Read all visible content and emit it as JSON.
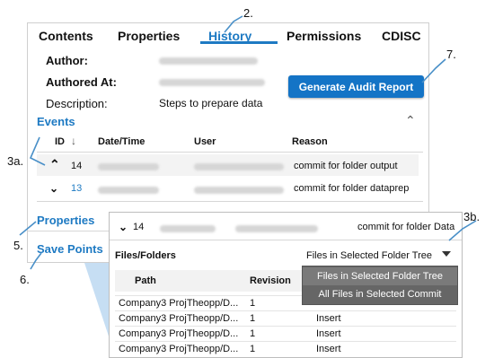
{
  "tabs": [
    "Contents",
    "Properties",
    "History",
    "Permissions",
    "CDISC"
  ],
  "active_tab": "History",
  "meta": {
    "author_label": "Author:",
    "authored_at_label": "Authored At:",
    "description_label": "Description:",
    "description_value": "Steps to prepare data"
  },
  "generate_button": "Generate Audit Report",
  "events": {
    "title": "Events",
    "headers": {
      "id": "ID",
      "datetime": "Date/Time",
      "user": "User",
      "reason": "Reason"
    },
    "rows": [
      {
        "id": "14",
        "reason": "commit for folder output"
      },
      {
        "id": "13",
        "reason": "commit for folder dataprep"
      }
    ]
  },
  "sections": {
    "properties": "Properties",
    "save_points": "Save Points"
  },
  "popup": {
    "id": "14",
    "reason": "commit for folder Data",
    "files_label": "Files/Folders",
    "dropdown_value": "Files in Selected Folder Tree",
    "headers": {
      "path": "Path",
      "revision": "Revision"
    },
    "rows": [
      {
        "path": "Company3 ProjTheopp/D...",
        "revision": "1",
        "action": ""
      },
      {
        "path": "Company3 ProjTheopp/D...",
        "revision": "1",
        "action": "Insert"
      },
      {
        "path": "Company3 ProjTheopp/D...",
        "revision": "1",
        "action": "Insert"
      },
      {
        "path": "Company3 ProjTheopp/D...",
        "revision": "1",
        "action": "Insert"
      }
    ],
    "menu": [
      "Files in Selected Folder Tree",
      "All Files in Selected Commit"
    ]
  },
  "callouts": {
    "c2": "2.",
    "c7": "7.",
    "c3a": "3a.",
    "c3b": "3b.",
    "c5": "5.",
    "c6": "6."
  },
  "colors": {
    "accent": "#1e7ac3",
    "button": "#1474c6",
    "callout_wedge": "#b9d7f0"
  }
}
